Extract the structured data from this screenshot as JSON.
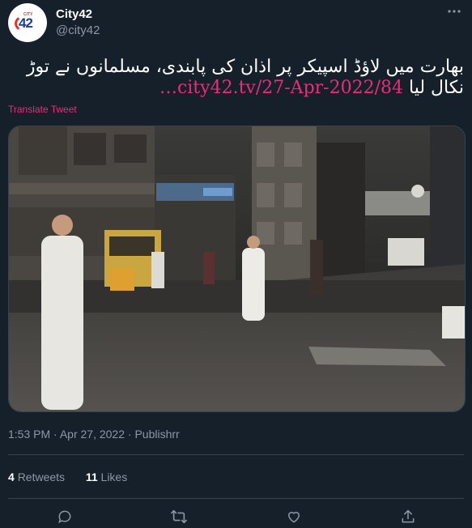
{
  "account": {
    "name": "City42",
    "handle": "@city42",
    "avatar_text": "42",
    "avatar_sub": "CITY"
  },
  "tweet": {
    "text_urdu": "بھارت میں لاؤڈ اسپیکر پر اذان کی پابندی، مسلمانوں نے توڑ نکال لیا",
    "link_text": "city42.tv/27-Apr-2022/84…",
    "translate_label": "Translate Tweet"
  },
  "meta": {
    "time": "1:53 PM",
    "date": "Apr 27, 2022",
    "source": "Publishrr",
    "sep": "·"
  },
  "stats": {
    "retweets_count": "4",
    "retweets_label": "Retweets",
    "likes_count": "11",
    "likes_label": "Likes"
  },
  "icons": {
    "more": "more-icon",
    "reply": "reply-icon",
    "retweet": "retweet-icon",
    "like": "like-icon",
    "share": "share-icon"
  },
  "colors": {
    "background": "#15202b",
    "link": "#ee2a7b",
    "secondary_text": "#8b98a5",
    "divider": "#38444d"
  }
}
